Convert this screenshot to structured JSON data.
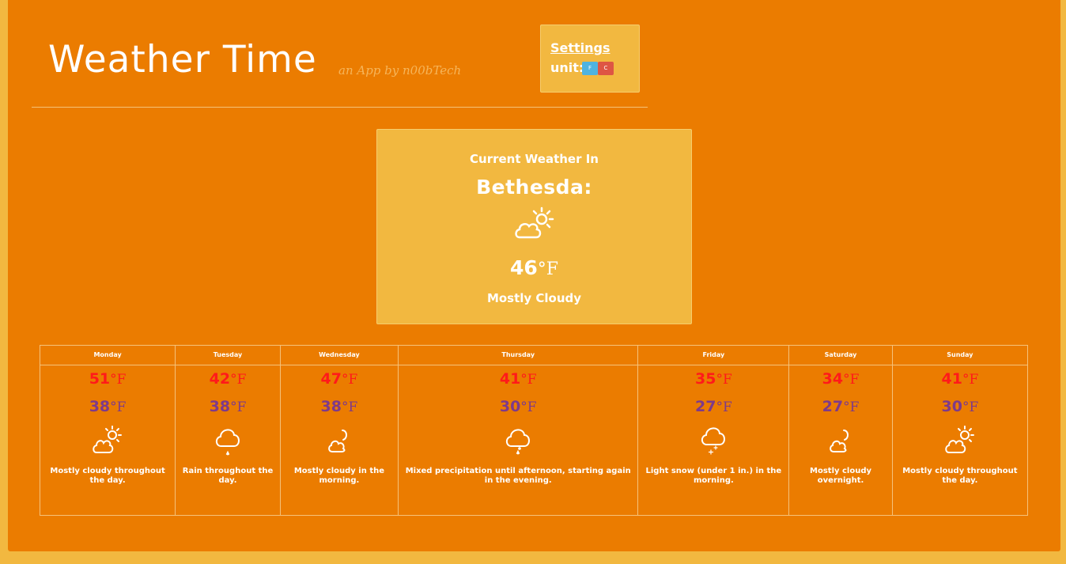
{
  "header": {
    "title": "Weather Time",
    "subtitle": "an App by n00bTech"
  },
  "settings": {
    "link_label": "Settings",
    "unit_label": "unit:",
    "units": [
      "F",
      "C"
    ]
  },
  "current": {
    "label": "Current Weather In",
    "city": "Bethesda:",
    "temp": "46",
    "unit": "°F",
    "condition": "Mostly Cloudy",
    "icon": "partly-cloudy-icon"
  },
  "forecast": [
    {
      "day": "Monday",
      "high": "51",
      "low": "38",
      "unit": "°F",
      "icon": "partly-cloudy-icon",
      "summary": "Mostly cloudy throughout the day."
    },
    {
      "day": "Tuesday",
      "high": "42",
      "low": "38",
      "unit": "°F",
      "icon": "rain-icon",
      "summary": "Rain throughout the day."
    },
    {
      "day": "Wednesday",
      "high": "47",
      "low": "38",
      "unit": "°F",
      "icon": "partly-cloudy-night-icon",
      "summary": "Mostly cloudy in the morning."
    },
    {
      "day": "Thursday",
      "high": "41",
      "low": "30",
      "unit": "°F",
      "icon": "sleet-icon",
      "summary": "Mixed precipitation until afternoon, starting again in the evening."
    },
    {
      "day": "Friday",
      "high": "35",
      "low": "27",
      "unit": "°F",
      "icon": "snow-icon",
      "summary": "Light snow (under 1 in.) in the morning."
    },
    {
      "day": "Saturday",
      "high": "34",
      "low": "27",
      "unit": "°F",
      "icon": "partly-cloudy-night-icon",
      "summary": "Mostly cloudy overnight."
    },
    {
      "day": "Sunday",
      "high": "41",
      "low": "30",
      "unit": "°F",
      "icon": "partly-cloudy-icon",
      "summary": "Mostly cloudy throughout the day."
    }
  ]
}
